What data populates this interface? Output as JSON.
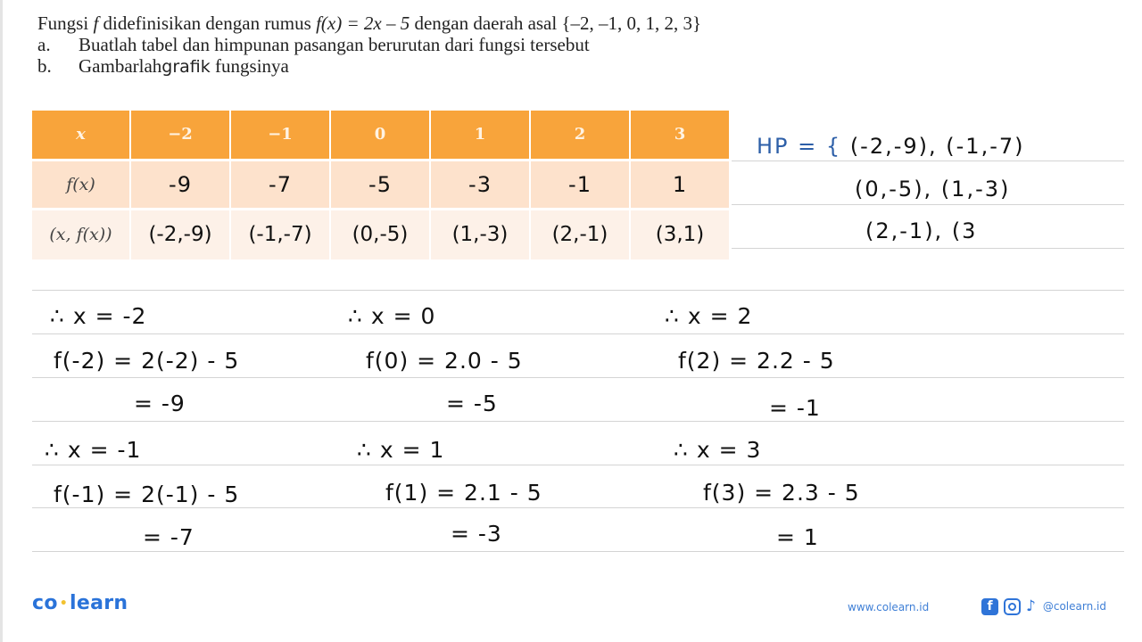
{
  "problem": {
    "line1": {
      "prefix": "Fungsi ",
      "f": "f",
      "middle": " didefinisikan dengan rumus ",
      "formula": "f(x) = 2x – 5",
      "suffix": " dengan daerah asal ",
      "domain": "{–2, –1, 0, 1, 2, 3}"
    },
    "item_a": {
      "label": "a.",
      "text": "Buatlah tabel dan himpunan pasangan berurutan dari fungsi tersebut"
    },
    "item_b": {
      "label": "b.",
      "text_1": "Gambarlah",
      "text_2": "grafik",
      "text_3": " fungsinya"
    }
  },
  "table": {
    "header": [
      "x",
      "−2",
      "−1",
      "0",
      "1",
      "2",
      "3"
    ],
    "row_fx": {
      "label": "f(x)",
      "values": [
        "-9",
        "-7",
        "-5",
        "-3",
        "-1",
        "1"
      ]
    },
    "row_pairs": {
      "label": "(x, f(x))",
      "values": [
        "(-2,-9)",
        "(-1,-7)",
        "(0,-5)",
        "(1,-3)",
        "(2,-1)",
        "(3,1)"
      ]
    },
    "colors": {
      "header_bg": "#f8a43b",
      "row1_bg": "#fde2cc",
      "row2_bg": "#fdf1e8"
    }
  },
  "ordered_pairs": {
    "label": "HP",
    "eq": " = {",
    "line1": "(-2,-9), (-1,-7)",
    "line2": "(0,-5), (1,-3)",
    "line3": "(2,-1), (3"
  },
  "work": [
    {
      "given": "∴ x = -2",
      "expr": "f(-2) = 2(-2) - 5",
      "result": "= -9"
    },
    {
      "given": "∴ x = 0",
      "expr": "f(0) = 2.0 - 5",
      "result": "= -5"
    },
    {
      "given": "∴ x = 2",
      "expr": "f(2) = 2.2 - 5",
      "result": "= -1"
    },
    {
      "given": "∴ x = -1",
      "expr": "f(-1) = 2(-1) - 5",
      "result": "= -7"
    },
    {
      "given": "∴ x = 1",
      "expr": "f(1) = 2.1 - 5",
      "result": "= -3"
    },
    {
      "given": "∴ x = 3",
      "expr": "f(3) = 2.3 - 5",
      "result": "= 1"
    }
  ],
  "footer": {
    "logo_left": "co",
    "logo_dot": "•",
    "logo_right": "learn",
    "url": "www.colearn.id",
    "facebook_glyph": "f",
    "tiktok_glyph": "♪",
    "handle": "@colearn.id",
    "brand_color": "#2a73d9"
  }
}
